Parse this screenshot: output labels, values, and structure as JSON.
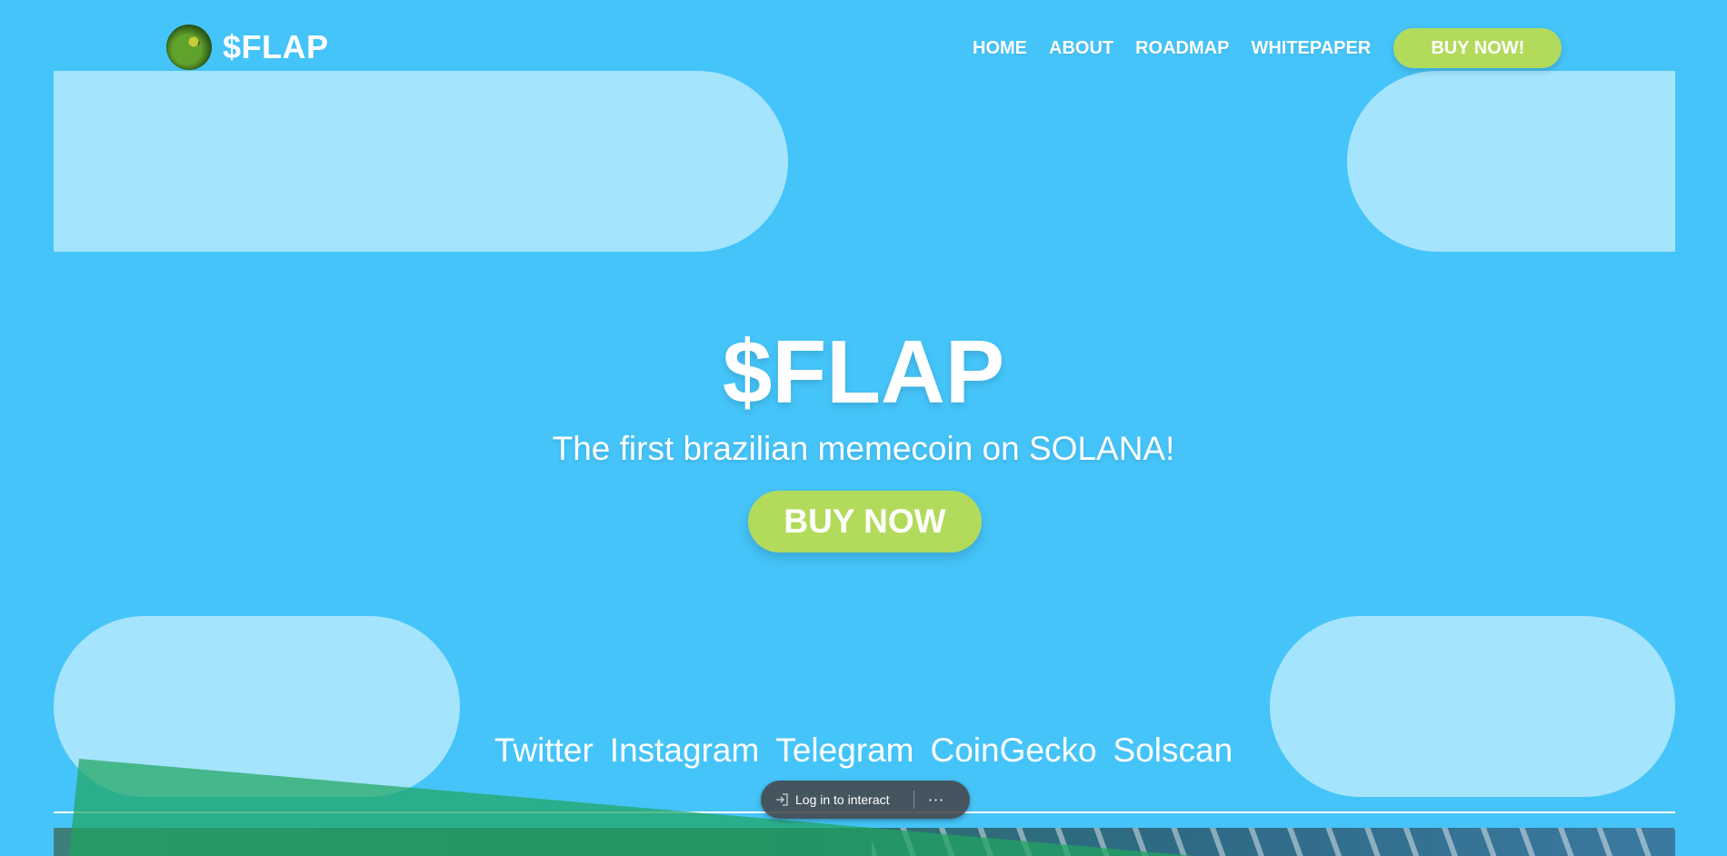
{
  "header": {
    "logo_text": "$FLAP",
    "nav": [
      {
        "label": "HOME"
      },
      {
        "label": "ABOUT"
      },
      {
        "label": "ROADMAP"
      },
      {
        "label": "WHITEPAPER"
      }
    ],
    "buy_label": "BUY NOW!"
  },
  "hero": {
    "title": "$FLAP",
    "subtitle": "The first brazilian memecoin on SOLANA!",
    "buy_label": "BUY NOW"
  },
  "socials": [
    {
      "label": "Twitter"
    },
    {
      "label": "Instagram"
    },
    {
      "label": "Telegram"
    },
    {
      "label": "CoinGecko"
    },
    {
      "label": "Solscan"
    }
  ],
  "overlay": {
    "login_label": "Log in to interact",
    "more_label": "···",
    "login_icon": "login-icon",
    "more_icon": "more-icon"
  },
  "colors": {
    "background": "#45c4f9",
    "blob": "#a5e4fd",
    "accent": "#b2db5c",
    "text": "#ffffff"
  }
}
